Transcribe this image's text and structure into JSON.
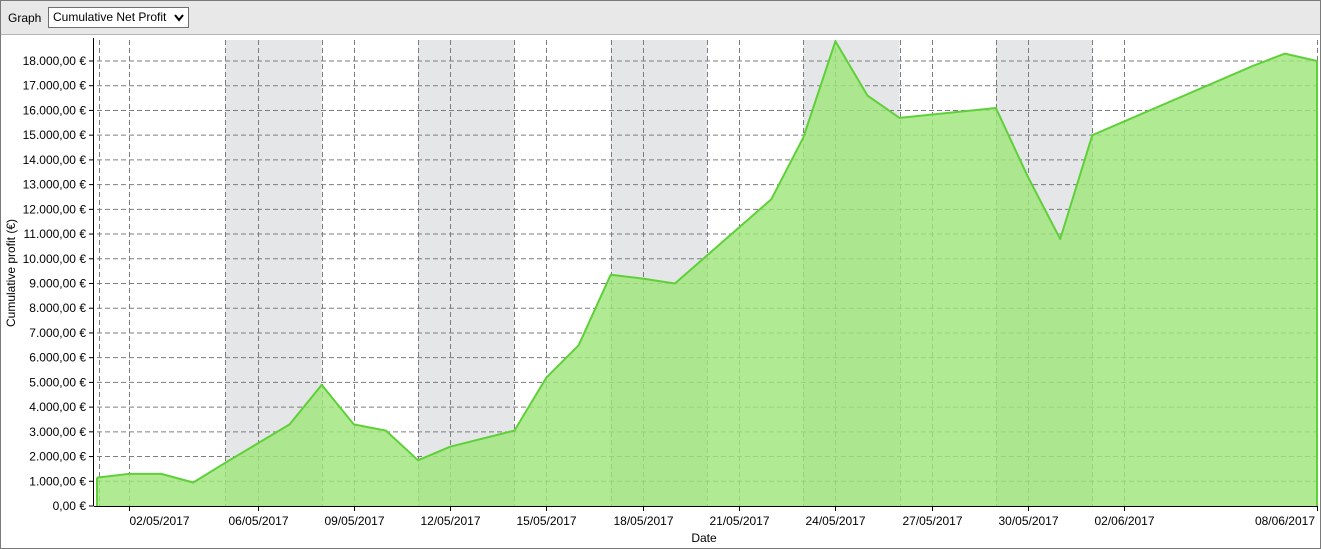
{
  "toolbar": {
    "graph_label": "Graph",
    "graph_selected": "Cumulative Net Profit"
  },
  "colors": {
    "fill": "#9fe57a",
    "line": "#5fd03a",
    "weekend_band": "#e5e6e8",
    "grid": "#7d7d7d"
  },
  "chart_data": {
    "type": "area",
    "xlabel": "Date",
    "ylabel": "Cumulative profit (€)",
    "ylim": [
      0,
      18000
    ],
    "yticks": [
      0,
      1000,
      2000,
      3000,
      4000,
      5000,
      6000,
      7000,
      8000,
      9000,
      10000,
      11000,
      12000,
      13000,
      14000,
      15000,
      16000,
      17000,
      18000
    ],
    "ytick_labels": [
      "0,00 €",
      "1.000,00 €",
      "2.000,00 €",
      "3.000,00 €",
      "4.000,00 €",
      "5.000,00 €",
      "6.000,00 €",
      "7.000,00 €",
      "8.000,00 €",
      "9.000,00 €",
      "10.000,00 €",
      "11.000,00 €",
      "12.000,00 €",
      "13.000,00 €",
      "14.000,00 €",
      "15.000,00 €",
      "16.000,00 €",
      "17.000,00 €",
      "18.000,00 €"
    ],
    "xlim": [
      "2017-05-01",
      "2017-06-08"
    ],
    "xticks": [
      "2017-05-02",
      "2017-05-06",
      "2017-05-09",
      "2017-05-12",
      "2017-05-15",
      "2017-05-18",
      "2017-05-21",
      "2017-05-24",
      "2017-05-27",
      "2017-05-30",
      "2017-06-02",
      "2017-06-08"
    ],
    "xtick_labels": [
      "02/05/2017",
      "06/05/2017",
      "09/05/2017",
      "12/05/2017",
      "15/05/2017",
      "18/05/2017",
      "21/05/2017",
      "24/05/2017",
      "27/05/2017",
      "30/05/2017",
      "02/06/2017",
      "08/06/2017"
    ],
    "weekend_bands": [
      [
        "2017-05-05",
        "2017-05-08"
      ],
      [
        "2017-05-11",
        "2017-05-14"
      ],
      [
        "2017-05-17",
        "2017-05-20"
      ],
      [
        "2017-05-23",
        "2017-05-26"
      ],
      [
        "2017-05-29",
        "2017-06-01"
      ]
    ],
    "grid": true,
    "series": [
      {
        "x": [
          "2017-05-01",
          "2017-05-02",
          "2017-05-03",
          "2017-05-04",
          "2017-05-05",
          "2017-05-07",
          "2017-05-08",
          "2017-05-09",
          "2017-05-10",
          "2017-05-11",
          "2017-05-12",
          "2017-05-14",
          "2017-05-15",
          "2017-05-16",
          "2017-05-17",
          "2017-05-18",
          "2017-05-19",
          "2017-05-22",
          "2017-05-23",
          "2017-05-24",
          "2017-05-25",
          "2017-05-26",
          "2017-05-29",
          "2017-05-30",
          "2017-05-31",
          "2017-06-01",
          "2017-06-06",
          "2017-06-07",
          "2017-06-08"
        ],
        "values": [
          1150,
          1300,
          1300,
          950,
          1750,
          3300,
          4900,
          3300,
          3050,
          1850,
          2400,
          3050,
          5200,
          6500,
          9350,
          9200,
          9000,
          12400,
          14900,
          18800,
          16600,
          15700,
          16100,
          13300,
          10800,
          15000,
          17800,
          18300,
          18000
        ]
      }
    ]
  }
}
